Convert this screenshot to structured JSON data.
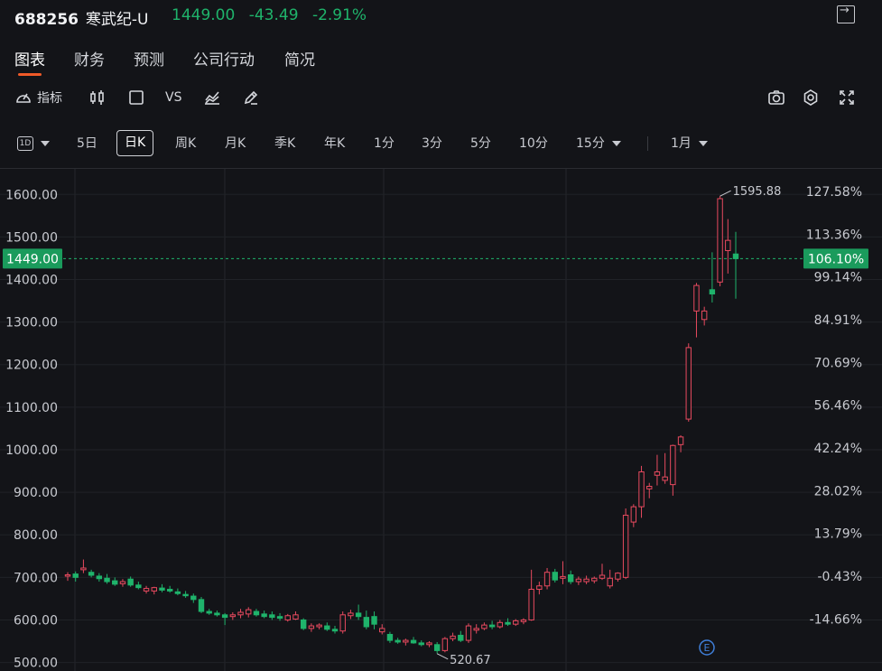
{
  "header": {
    "code": "688256",
    "name": "寒武纪-U",
    "price": "1449.00",
    "change": "-43.49",
    "change_pct": "-2.91%",
    "quote_color": "#1fb36b"
  },
  "tabs": [
    {
      "label": "图表",
      "active": true
    },
    {
      "label": "财务"
    },
    {
      "label": "预测"
    },
    {
      "label": "公司行动"
    },
    {
      "label": "简况"
    }
  ],
  "toolbar": {
    "indicator_label": "指标",
    "vs_label": "VS",
    "icons": [
      "indicator-icon",
      "candlestick-icon",
      "square-icon",
      "chart-draw-icon",
      "pencil-icon",
      "camera-icon",
      "gear-icon",
      "fullscreen-icon"
    ]
  },
  "periods": {
    "type_badge": "1D",
    "items": [
      "5日",
      "日K",
      "周K",
      "月K",
      "季K",
      "年K",
      "1分",
      "3分",
      "5分",
      "10分",
      "15分"
    ],
    "active": "日K",
    "range": "1月"
  },
  "chart_data": {
    "type": "candlestick",
    "ylim": [
      480,
      1660
    ],
    "y_ticks": [
      "1600.00",
      "1500.00",
      "1400.00",
      "1300.00",
      "1200.00",
      "1100.00",
      "1000.00",
      "900.00",
      "800.00",
      "700.00",
      "600.00",
      "500.00"
    ],
    "right_ticks": [
      "127.58%",
      "113.36%",
      "99.14%",
      "84.91%",
      "70.69%",
      "56.46%",
      "42.24%",
      "28.02%",
      "13.79%",
      "-0.43%",
      "-14.66%"
    ],
    "current_price_label": "1449.00",
    "current_pct_label": "106.10%",
    "current_price": 1449,
    "high_label": "1595.88",
    "high_value": 1595.88,
    "low_label": "520.67",
    "low_value": 520.67,
    "up_color": "#e84a5f",
    "down_color": "#1fb36b",
    "badge": "E",
    "candles": [
      {
        "o": 703,
        "h": 712,
        "l": 692,
        "c": 706
      },
      {
        "o": 708,
        "h": 714,
        "l": 690,
        "c": 700
      },
      {
        "o": 718,
        "h": 742,
        "l": 710,
        "c": 722
      },
      {
        "o": 712,
        "h": 718,
        "l": 700,
        "c": 705
      },
      {
        "o": 703,
        "h": 710,
        "l": 690,
        "c": 697
      },
      {
        "o": 698,
        "h": 708,
        "l": 685,
        "c": 690
      },
      {
        "o": 692,
        "h": 700,
        "l": 680,
        "c": 684
      },
      {
        "o": 685,
        "h": 696,
        "l": 678,
        "c": 690
      },
      {
        "o": 696,
        "h": 702,
        "l": 678,
        "c": 682
      },
      {
        "o": 682,
        "h": 690,
        "l": 672,
        "c": 676
      },
      {
        "o": 668,
        "h": 680,
        "l": 662,
        "c": 674
      },
      {
        "o": 668,
        "h": 678,
        "l": 660,
        "c": 676
      },
      {
        "o": 675,
        "h": 684,
        "l": 665,
        "c": 670
      },
      {
        "o": 672,
        "h": 680,
        "l": 664,
        "c": 668
      },
      {
        "o": 666,
        "h": 674,
        "l": 658,
        "c": 662
      },
      {
        "o": 660,
        "h": 668,
        "l": 652,
        "c": 658
      },
      {
        "o": 656,
        "h": 662,
        "l": 640,
        "c": 648
      },
      {
        "o": 648,
        "h": 654,
        "l": 616,
        "c": 620
      },
      {
        "o": 620,
        "h": 626,
        "l": 612,
        "c": 616
      },
      {
        "o": 616,
        "h": 622,
        "l": 608,
        "c": 612
      },
      {
        "o": 612,
        "h": 616,
        "l": 588,
        "c": 606
      },
      {
        "o": 608,
        "h": 618,
        "l": 600,
        "c": 612
      },
      {
        "o": 612,
        "h": 626,
        "l": 604,
        "c": 618
      },
      {
        "o": 614,
        "h": 630,
        "l": 606,
        "c": 624
      },
      {
        "o": 620,
        "h": 626,
        "l": 608,
        "c": 612
      },
      {
        "o": 614,
        "h": 622,
        "l": 604,
        "c": 608
      },
      {
        "o": 612,
        "h": 620,
        "l": 600,
        "c": 606
      },
      {
        "o": 608,
        "h": 616,
        "l": 598,
        "c": 604
      },
      {
        "o": 600,
        "h": 614,
        "l": 596,
        "c": 610
      },
      {
        "o": 602,
        "h": 620,
        "l": 600,
        "c": 612
      },
      {
        "o": 600,
        "h": 604,
        "l": 576,
        "c": 580
      },
      {
        "o": 580,
        "h": 592,
        "l": 572,
        "c": 586
      },
      {
        "o": 584,
        "h": 592,
        "l": 578,
        "c": 588
      },
      {
        "o": 586,
        "h": 594,
        "l": 574,
        "c": 578
      },
      {
        "o": 578,
        "h": 586,
        "l": 568,
        "c": 574
      },
      {
        "o": 574,
        "h": 620,
        "l": 568,
        "c": 612
      },
      {
        "o": 610,
        "h": 624,
        "l": 602,
        "c": 616
      },
      {
        "o": 616,
        "h": 636,
        "l": 600,
        "c": 608
      },
      {
        "o": 606,
        "h": 622,
        "l": 578,
        "c": 584
      },
      {
        "o": 608,
        "h": 620,
        "l": 578,
        "c": 590
      },
      {
        "o": 572,
        "h": 590,
        "l": 566,
        "c": 580
      },
      {
        "o": 566,
        "h": 572,
        "l": 546,
        "c": 552
      },
      {
        "o": 552,
        "h": 558,
        "l": 544,
        "c": 548
      },
      {
        "o": 548,
        "h": 556,
        "l": 540,
        "c": 552
      },
      {
        "o": 552,
        "h": 560,
        "l": 544,
        "c": 546
      },
      {
        "o": 546,
        "h": 552,
        "l": 538,
        "c": 542
      },
      {
        "o": 542,
        "h": 550,
        "l": 536,
        "c": 546
      },
      {
        "o": 542,
        "h": 548,
        "l": 521,
        "c": 528
      },
      {
        "o": 528,
        "h": 560,
        "l": 524,
        "c": 556
      },
      {
        "o": 556,
        "h": 570,
        "l": 550,
        "c": 562
      },
      {
        "o": 564,
        "h": 574,
        "l": 548,
        "c": 552
      },
      {
        "o": 552,
        "h": 592,
        "l": 546,
        "c": 586
      },
      {
        "o": 576,
        "h": 590,
        "l": 568,
        "c": 580
      },
      {
        "o": 580,
        "h": 594,
        "l": 576,
        "c": 588
      },
      {
        "o": 588,
        "h": 598,
        "l": 578,
        "c": 584
      },
      {
        "o": 584,
        "h": 600,
        "l": 580,
        "c": 594
      },
      {
        "o": 594,
        "h": 604,
        "l": 586,
        "c": 590
      },
      {
        "o": 590,
        "h": 602,
        "l": 586,
        "c": 598
      },
      {
        "o": 596,
        "h": 604,
        "l": 590,
        "c": 600
      },
      {
        "o": 600,
        "h": 718,
        "l": 598,
        "c": 672
      },
      {
        "o": 672,
        "h": 690,
        "l": 660,
        "c": 680
      },
      {
        "o": 680,
        "h": 722,
        "l": 672,
        "c": 712
      },
      {
        "o": 712,
        "h": 720,
        "l": 688,
        "c": 694
      },
      {
        "o": 698,
        "h": 738,
        "l": 684,
        "c": 702
      },
      {
        "o": 706,
        "h": 716,
        "l": 684,
        "c": 690
      },
      {
        "o": 690,
        "h": 702,
        "l": 682,
        "c": 696
      },
      {
        "o": 690,
        "h": 704,
        "l": 684,
        "c": 696
      },
      {
        "o": 692,
        "h": 702,
        "l": 686,
        "c": 698
      },
      {
        "o": 698,
        "h": 732,
        "l": 694,
        "c": 705
      },
      {
        "o": 680,
        "h": 718,
        "l": 674,
        "c": 698
      },
      {
        "o": 696,
        "h": 712,
        "l": 690,
        "c": 710
      },
      {
        "o": 700,
        "h": 862,
        "l": 696,
        "c": 846
      },
      {
        "o": 830,
        "h": 872,
        "l": 818,
        "c": 866
      },
      {
        "o": 866,
        "h": 962,
        "l": 840,
        "c": 948
      },
      {
        "o": 908,
        "h": 922,
        "l": 886,
        "c": 914
      },
      {
        "o": 940,
        "h": 988,
        "l": 916,
        "c": 948
      },
      {
        "o": 928,
        "h": 992,
        "l": 920,
        "c": 936
      },
      {
        "o": 918,
        "h": 1012,
        "l": 892,
        "c": 1010
      },
      {
        "o": 1012,
        "h": 1034,
        "l": 994,
        "c": 1030
      },
      {
        "o": 1072,
        "h": 1250,
        "l": 1066,
        "c": 1240
      },
      {
        "o": 1326,
        "h": 1392,
        "l": 1264,
        "c": 1386
      },
      {
        "o": 1306,
        "h": 1336,
        "l": 1292,
        "c": 1326
      },
      {
        "o": 1376,
        "h": 1464,
        "l": 1346,
        "c": 1366
      },
      {
        "o": 1394,
        "h": 1596,
        "l": 1384,
        "c": 1590
      },
      {
        "o": 1468,
        "h": 1542,
        "l": 1414,
        "c": 1492
      },
      {
        "o": 1460,
        "h": 1512,
        "l": 1355,
        "c": 1449
      }
    ]
  }
}
